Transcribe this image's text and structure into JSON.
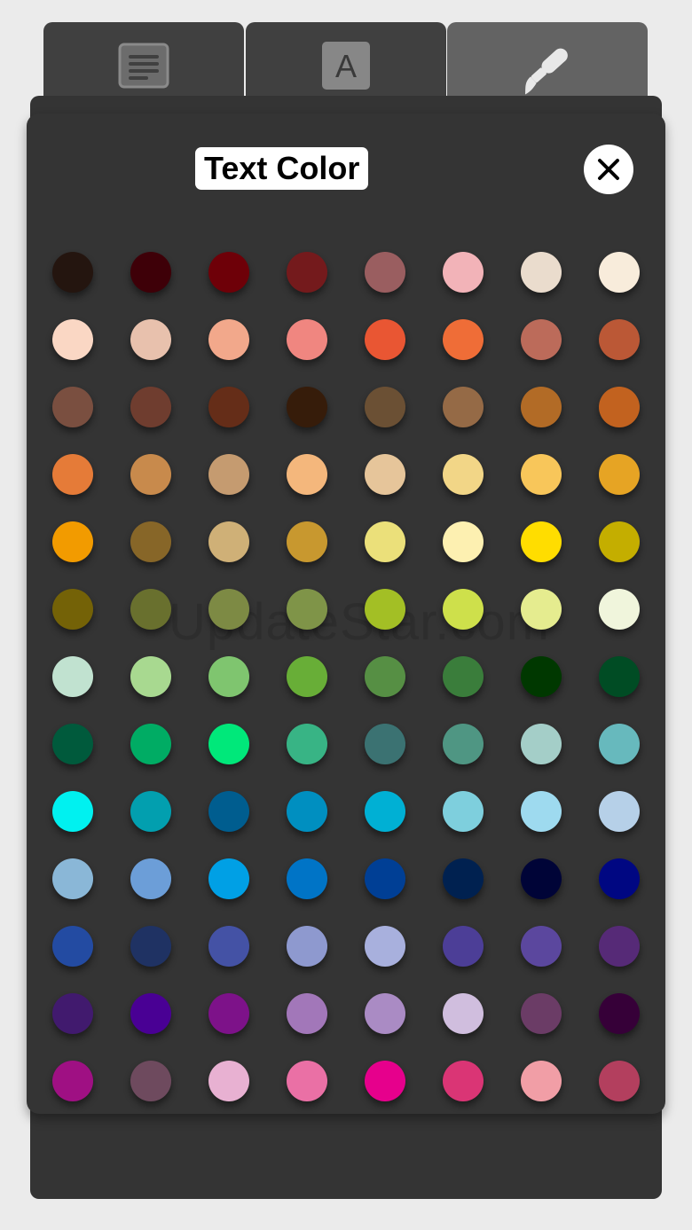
{
  "tabs": [
    {
      "name": "paragraph",
      "icon": "paragraph-icon"
    },
    {
      "name": "font",
      "icon": "font-icon",
      "glyph": "A"
    },
    {
      "name": "style",
      "icon": "paintbrush-icon",
      "active": true
    }
  ],
  "header": {
    "title": "Text Color",
    "close_icon": "close-icon"
  },
  "watermark": "UpdateStar.com",
  "palette": [
    [
      "#24150f",
      "#3e0008",
      "#6e0008",
      "#741a1c",
      "#9a5e60",
      "#f2b3b8",
      "#eadccd",
      "#f8ecdb"
    ],
    [
      "#fad7c4",
      "#e8c1ad",
      "#f2a88b",
      "#f08680",
      "#e95633",
      "#ef6d37",
      "#bc6b5a",
      "#bb5836"
    ],
    [
      "#7a4f40",
      "#6f3d2f",
      "#652d18",
      "#361c0a",
      "#6b5034",
      "#956a46",
      "#b26b26",
      "#c2621f"
    ],
    [
      "#e57b38",
      "#c88a4c",
      "#c59b70",
      "#f4b77c",
      "#e6c59a",
      "#f2d687",
      "#f8c65a",
      "#e6a424"
    ],
    [
      "#f29b00",
      "#876628",
      "#cfb077",
      "#c8982f",
      "#ebe07a",
      "#fdf0b1",
      "#ffdd00",
      "#c4ae00"
    ],
    [
      "#746207",
      "#69702e",
      "#7d8a44",
      "#7f9448",
      "#a3bf25",
      "#cee04b",
      "#e5ec8f",
      "#f0f5dc"
    ],
    [
      "#c1e2d0",
      "#a8d990",
      "#7fc56f",
      "#68ae37",
      "#568f44",
      "#3a7d3b",
      "#003800",
      "#004c24"
    ],
    [
      "#005a3c",
      "#00ac64",
      "#00e87a",
      "#38b485",
      "#3b7272",
      "#4f9683",
      "#a4cec8",
      "#67b9bd"
    ],
    [
      "#00f1f0",
      "#029faf",
      "#005d8f",
      "#008fc0",
      "#00b0d4",
      "#7ecfdd",
      "#9edaef",
      "#b6d0e8"
    ],
    [
      "#8ab7d7",
      "#6c9ed8",
      "#00a0e5",
      "#0074c6",
      "#003f95",
      "#002150",
      "#000437",
      "#000782"
    ],
    [
      "#234ba2",
      "#1f3263",
      "#4452a5",
      "#8e99cf",
      "#a8b0dd",
      "#4c3e97",
      "#5b479e",
      "#562a77"
    ],
    [
      "#411a6e",
      "#490094",
      "#7d1289",
      "#a277b9",
      "#aa8bc4",
      "#d0bede",
      "#6b3c66",
      "#360038"
    ],
    [
      "#9f1083",
      "#6e4a5e",
      "#e8b1d2",
      "#ea70a5",
      "#e6008c",
      "#da3575",
      "#f19ea6",
      "#b33f5e"
    ]
  ]
}
